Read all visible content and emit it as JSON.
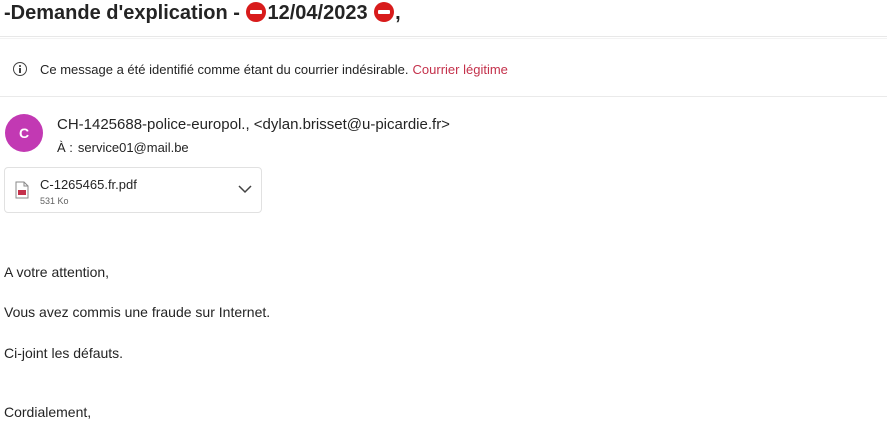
{
  "subject": {
    "prefix": "-Demande d'explication - ",
    "date": "12/04/2023",
    "suffix": ","
  },
  "junk_notice": {
    "text": "Ce message a été identifié comme étant du courrier indésirable.",
    "link": "Courrier légitime",
    "link_color": "#c4314b"
  },
  "sender": {
    "avatar_initial": "C",
    "avatar_color": "#c239b3",
    "name": "CH-1425688-police-europol.,",
    "email": "<dylan.brisset@u-picardie.fr>"
  },
  "recipient": {
    "label": "À :",
    "address": "service01@mail.be"
  },
  "attachment": {
    "icon": "pdf-file-icon",
    "name": "C-1265465.fr.pdf",
    "size": "531 Ko"
  },
  "body": {
    "greeting": "A votre attention,",
    "line1": "Vous avez commis une fraude sur Internet.",
    "line2": "Ci-joint les défauts.",
    "closing": "Cordialement,"
  },
  "icons": {
    "subject_marker": "no-entry-emoji",
    "notice": "info-icon",
    "expand": "chevron-down-icon"
  }
}
